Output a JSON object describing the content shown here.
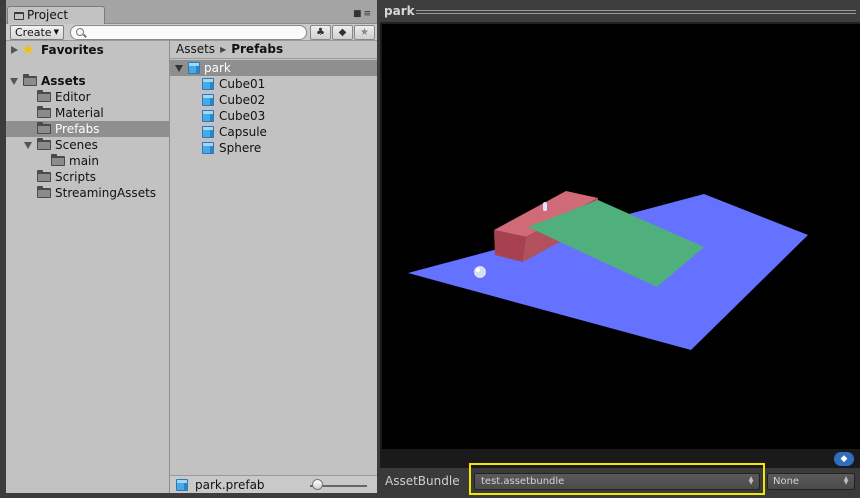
{
  "project": {
    "tab_title": "Project",
    "create_label": "Create",
    "search_value": "",
    "tree": {
      "favorites": "Favorites",
      "assets": "Assets",
      "items": [
        "Editor",
        "Material",
        "Prefabs",
        "Scenes",
        "main",
        "Scripts",
        "StreamingAssets"
      ]
    },
    "breadcrumb": [
      "Assets",
      "Prefabs"
    ],
    "list": {
      "parent": "park",
      "children": [
        "Cube01",
        "Cube02",
        "Cube03",
        "Capsule",
        "Sphere"
      ]
    },
    "status": {
      "filename": "park.prefab",
      "zoom": 0.1
    }
  },
  "preview": {
    "title": "park",
    "assetbundle_label": "AssetBundle",
    "assetbundle_value": "test.assetbundle",
    "variant_value": "None",
    "colors": {
      "ground": "#6571ff",
      "green_plane": "#4fb07e",
      "red_box": "#b3505e",
      "highlight": "#f1e700"
    }
  },
  "icons": {
    "tab": "folder-icon",
    "favorites": "star-icon",
    "asset": "prefab-cube-icon",
    "lock": "lock-icon",
    "menu": "menu-icon",
    "filter_type": "type-filter-icon",
    "filter_label": "label-filter-icon",
    "favorite_toggle": "star-icon",
    "asset_label": "tag-icon"
  }
}
